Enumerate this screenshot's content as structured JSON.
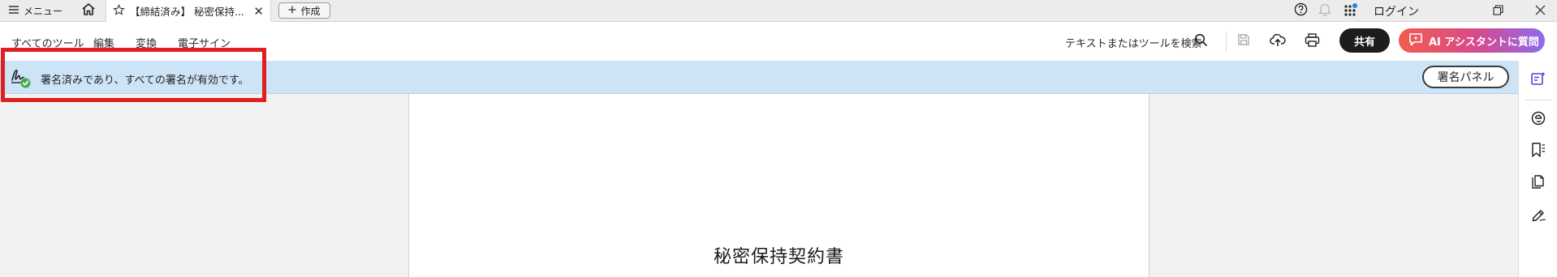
{
  "tabbar": {
    "menu_label": "メニュー",
    "tab_title": "【締結済み】 秘密保持...",
    "create_label": "作成",
    "login_label": "ログイン",
    "icons": [
      "hamburger-icon",
      "home-icon",
      "star-icon",
      "close-icon",
      "plus-icon",
      "help-icon",
      "bell-icon",
      "apps-grid-icon",
      "restore-window-icon",
      "close-window-icon"
    ]
  },
  "toolbar": {
    "menus": [
      "すべてのツール",
      "編集",
      "変換",
      "電子サイン"
    ],
    "search_label": "テキストまたはツールを検索",
    "share_label": "共有",
    "ai_label": "AI アシスタントに質問",
    "icons": [
      "search-icon",
      "save-icon",
      "upload-cloud-icon",
      "print-icon",
      "ai-chat-icon"
    ]
  },
  "signature_bar": {
    "message": "署名済みであり、すべての署名が有効です。",
    "panel_button": "署名パネル",
    "icons": [
      "signature-valid-icon"
    ]
  },
  "document": {
    "title": "秘密保持契約書"
  },
  "right_rail": {
    "icons": [
      "comment-panel-icon",
      "export-icon",
      "bookmarks-icon",
      "pages-icon",
      "fill-sign-icon"
    ]
  },
  "colors": {
    "banner": "#cde3f6",
    "highlight": "#e02020",
    "share_button": "#1d1d1d",
    "ai_gradient_start": "#f25c4e",
    "ai_gradient_end": "#8b6cf0",
    "valid_check": "#3fae49",
    "notification_dot": "#2d7be5"
  }
}
